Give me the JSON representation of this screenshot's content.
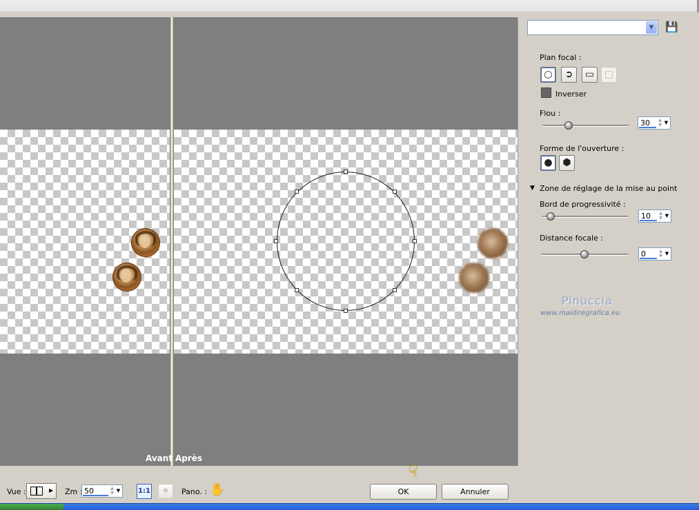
{
  "window": {
    "title": ""
  },
  "preview": {
    "before_label": "Avant",
    "after_label": "Après"
  },
  "panel": {
    "preset": {
      "value": ""
    },
    "focal_plane": {
      "label": "Plan focal :",
      "tools": [
        "ellipse-icon",
        "lasso-icon",
        "rectangle-icon",
        "rect-soft-icon"
      ],
      "invert_label": "Inverser"
    },
    "blur": {
      "label": "Flou :",
      "value": "30",
      "fraction": 0.3
    },
    "aperture": {
      "label": "Forme de l'ouverture :",
      "shapes": [
        "circle-icon",
        "hexagon-icon"
      ]
    },
    "focus_section": {
      "label": "Zone de réglage de la mise au point"
    },
    "feather": {
      "label": "Bord de progressivité :",
      "value": "10",
      "fraction": 0.1
    },
    "focal_distance": {
      "label": "Distance focale :",
      "value": "0",
      "fraction": 0.5
    },
    "watermark": {
      "name": "Pinuccia",
      "site": "www.maidiregrafica.eu"
    }
  },
  "bottom": {
    "view_label": "Vue :",
    "zoom_label": "Zm :",
    "zoom_value": "50",
    "one_to_one": "1:1",
    "pan_label": "Pano. :",
    "ok_label": "OK",
    "cancel_label": "Annuler"
  },
  "colors": {
    "preview_bg": "#7f7f7f",
    "panel_bg": "#d4d0c8",
    "taskbar": "#245edb"
  }
}
